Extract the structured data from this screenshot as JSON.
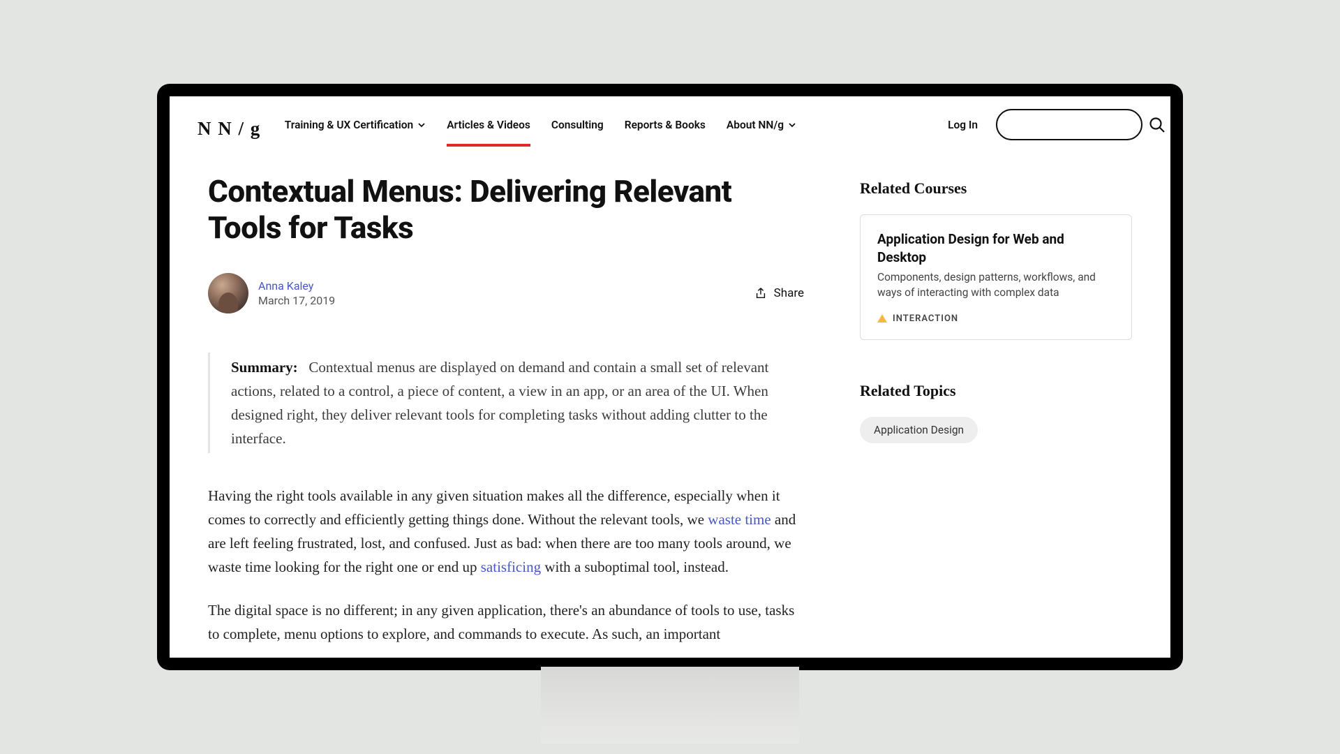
{
  "logo": "N N / g",
  "nav": {
    "items": [
      {
        "label": "Training & UX Certification",
        "hasDropdown": true,
        "active": false
      },
      {
        "label": "Articles & Videos",
        "hasDropdown": false,
        "active": true
      },
      {
        "label": "Consulting",
        "hasDropdown": false,
        "active": false
      },
      {
        "label": "Reports & Books",
        "hasDropdown": false,
        "active": false
      },
      {
        "label": "About NN/g",
        "hasDropdown": true,
        "active": false
      }
    ],
    "login": "Log In",
    "search_placeholder": ""
  },
  "article": {
    "title": "Contextual Menus: Delivering Relevant Tools for Tasks",
    "author": "Anna Kaley",
    "date": "March 17, 2019",
    "share_label": "Share",
    "summary_label": "Summary:",
    "summary_text": "Contextual menus are displayed on demand and contain a small set of relevant actions, related to a control, a piece of content, a view in an app, or an area of the UI. When designed right, they deliver relevant tools for completing tasks without adding clutter to the interface.",
    "p1_a": "Having the right tools available in any given situation makes all the difference, especially when it comes to correctly and efficiently getting things done. Without the relevant tools, we ",
    "p1_link1": "waste time",
    "p1_b": " and are left feeling frustrated, lost, and confused. Just as bad: when there are too many tools around, we waste time looking for the right one or end up ",
    "p1_link2": "satisficing",
    "p1_c": " with a suboptimal tool, instead.",
    "p2": "The digital space is no different; in any given application, there's an abundance of tools to use, tasks to complete, menu options to explore, and commands to execute. As such, an important"
  },
  "sidebar": {
    "courses_heading": "Related Courses",
    "course": {
      "title": "Application Design for Web and Desktop",
      "subtitle": "Components, design patterns, workflows, and ways of interacting with complex data",
      "tag": "INTERACTION"
    },
    "topics_heading": "Related Topics",
    "topic": "Application Design"
  }
}
